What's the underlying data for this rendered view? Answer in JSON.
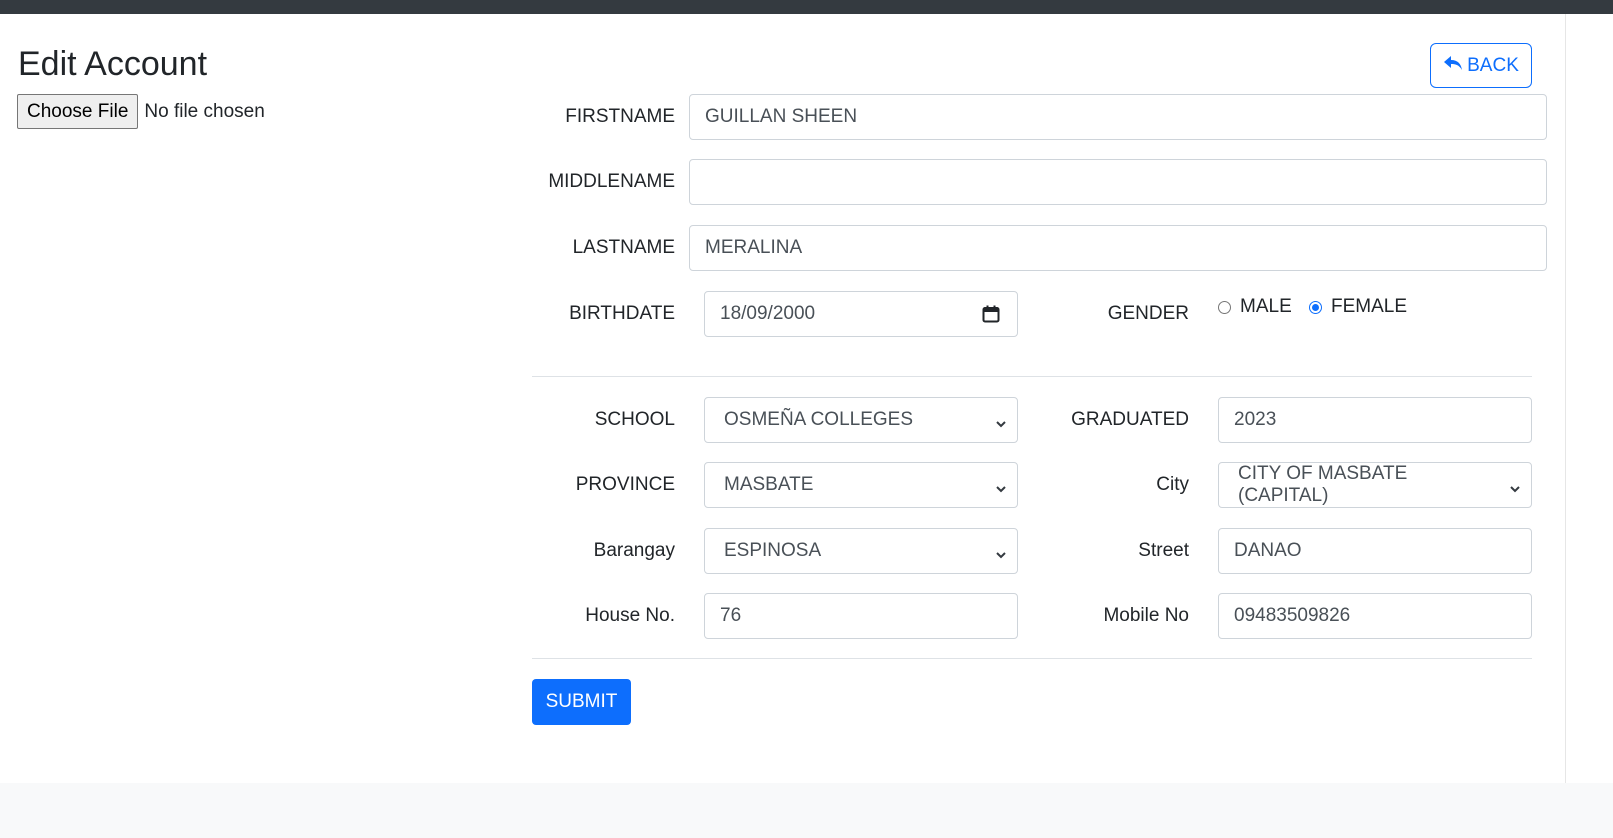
{
  "page": {
    "title": "Edit Account"
  },
  "file_input": {
    "button_label": "Choose File",
    "status": "No file chosen"
  },
  "back_button": {
    "label": "BACK",
    "icon": "reply-arrow-icon"
  },
  "form": {
    "firstname": {
      "label": "FIRSTNAME",
      "value": "GUILLAN SHEEN"
    },
    "middlename": {
      "label": "MIDDLENAME",
      "value": ""
    },
    "lastname": {
      "label": "LASTNAME",
      "value": "MERALINA"
    },
    "birthdate": {
      "label": "BIRTHDATE",
      "value": "18/09/2000"
    },
    "gender": {
      "label": "GENDER",
      "options": [
        {
          "label": "MALE",
          "checked": false
        },
        {
          "label": "FEMALE",
          "checked": true
        }
      ]
    },
    "school": {
      "label": "SCHOOL",
      "value": "OSMEÑA COLLEGES"
    },
    "graduated": {
      "label": "GRADUATED",
      "value": "2023"
    },
    "province": {
      "label": "PROVINCE",
      "value": "MASBATE"
    },
    "city": {
      "label": "City",
      "value": "CITY OF MASBATE (CAPITAL)"
    },
    "barangay": {
      "label": "Barangay",
      "value": "ESPINOSA"
    },
    "street": {
      "label": "Street",
      "value": "DANAO"
    },
    "house_no": {
      "label": "House No.",
      "value": "76"
    },
    "mobile_no": {
      "label": "Mobile No",
      "value": "09483509826"
    }
  },
  "submit_button": {
    "label": "SUBMIT"
  },
  "colors": {
    "primary": "#0d6efd",
    "topbar": "#343a40",
    "footer": "#f8f9fa",
    "border": "#ced4da"
  }
}
